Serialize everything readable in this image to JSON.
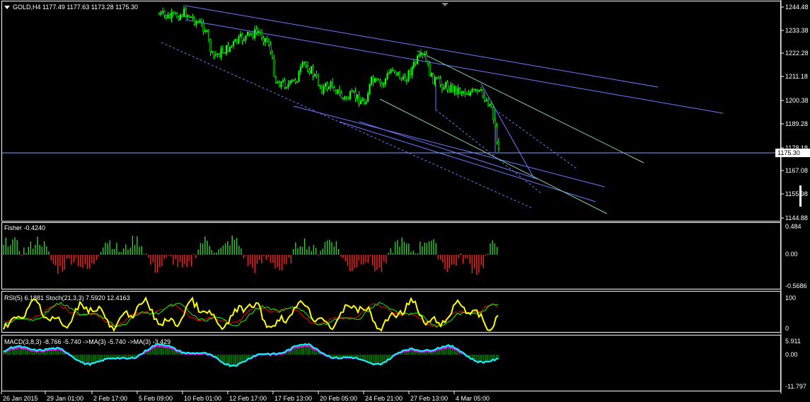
{
  "main_panel": {
    "title": "GOLD,H4  1177.49 1177.63 1173.28 1175.30",
    "price_labels": [
      "1244.48",
      "1233.38",
      "1222.28",
      "1211.18",
      "1200.38",
      "1189.28",
      "1178.18",
      "1167.08",
      "1155.98",
      "1144.88"
    ],
    "current_price": "1175.30",
    "colors": {
      "bull": "#00ff00",
      "bear": "#00ff00",
      "channel": "#6a7cff",
      "green_line": "#7fcf9f",
      "current_line": "#7f9fff"
    }
  },
  "fisher_panel": {
    "title": "Fisher -0.4240",
    "labels": [
      "0.484",
      "0.00",
      "-0.5686"
    ],
    "colors": {
      "positive": "#32cd32",
      "negative": "#ff2020"
    }
  },
  "rsi_panel": {
    "title": "RSI(5) 6.1881  Stoch(21,3,3) 7.5920 12.4163",
    "labels": [
      "100",
      "0"
    ],
    "colors": {
      "rsi": "#ffff00",
      "stoch_main": "#00ff00",
      "stoch_signal": "#ff0000"
    }
  },
  "macd_panel": {
    "title": "MACD(3,8,3) -8.766 -5.740  ->MA(3) -5.740  ->MA(3) -3.429",
    "labels": [
      "5.911",
      "0.00",
      "-11.797"
    ],
    "colors": {
      "hist_pos": "#008000",
      "hist_neg": "#008000",
      "line1": "#00ffff",
      "line2": "#ff00ff"
    }
  },
  "time_axis": [
    "26 Jan 2015",
    "29 Jan 01:00",
    "2 Feb 17:00",
    "5 Feb 09:00",
    "10 Feb 01:00",
    "12 Feb 17:00",
    "17 Feb 13:00",
    "20 Feb 05:00",
    "24 Feb 21:00",
    "27 Feb 13:00",
    "4 Mar 05:00"
  ]
}
